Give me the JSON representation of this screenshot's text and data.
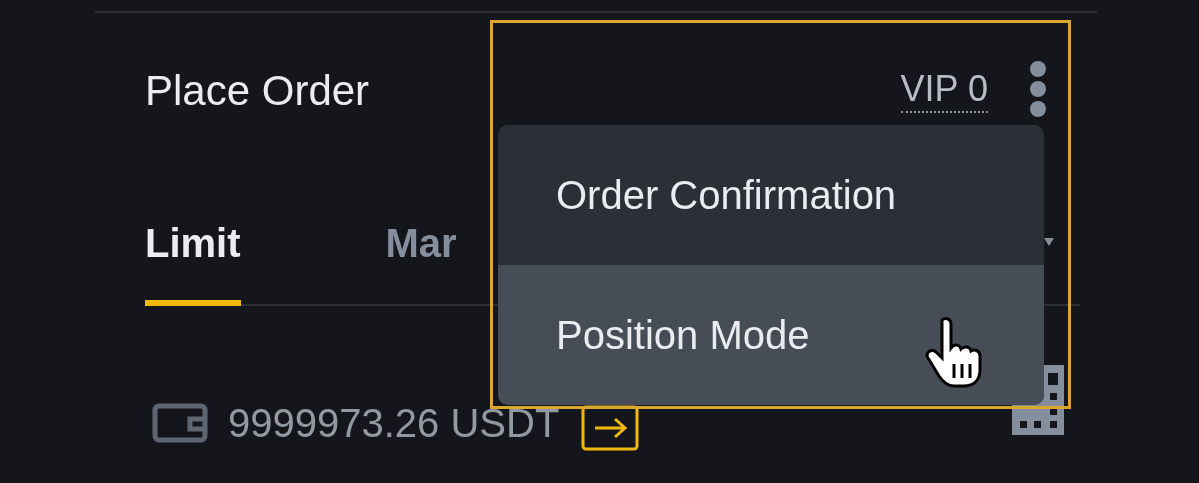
{
  "panel": {
    "title": "Place Order",
    "vip_level": "VIP 0"
  },
  "tabs": [
    {
      "label": "Limit",
      "selected": true
    },
    {
      "label": "Mar",
      "selected": false
    }
  ],
  "balance": {
    "amount": "9999973.26 USDT"
  },
  "menu": {
    "items": [
      {
        "label": "Order Confirmation",
        "hovered": false
      },
      {
        "label": "Position Mode",
        "hovered": true
      }
    ]
  }
}
